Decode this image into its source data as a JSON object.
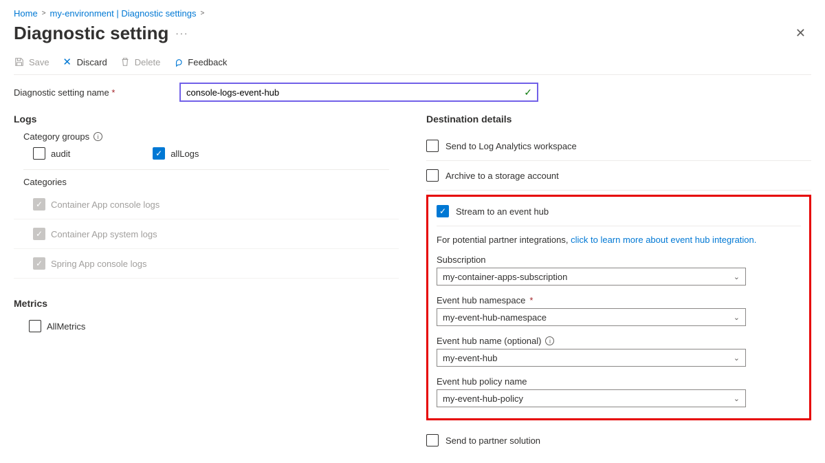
{
  "breadcrumb": {
    "home": "Home",
    "env": "my-environment | Diagnostic settings"
  },
  "page_title": "Diagnostic setting",
  "toolbar": {
    "save": "Save",
    "discard": "Discard",
    "delete": "Delete",
    "feedback": "Feedback"
  },
  "name_field": {
    "label": "Diagnostic setting name",
    "value": "console-logs-event-hub"
  },
  "logs": {
    "heading": "Logs",
    "category_groups_label": "Category groups",
    "groups": {
      "audit": "audit",
      "allLogs": "allLogs"
    },
    "categories_label": "Categories",
    "categories": [
      "Container App console logs",
      "Container App system logs",
      "Spring App console logs"
    ]
  },
  "metrics": {
    "heading": "Metrics",
    "all": "AllMetrics"
  },
  "dest": {
    "heading": "Destination details",
    "law": "Send to Log Analytics workspace",
    "storage": "Archive to a storage account",
    "eventhub": "Stream to an event hub",
    "partner": "Send to partner solution",
    "partner_text": "For potential partner integrations, ",
    "partner_link": "click to learn more about event hub integration.",
    "fields": {
      "sub_label": "Subscription",
      "sub_value": "my-container-apps-subscription",
      "ns_label": "Event hub namespace",
      "ns_value": "my-event-hub-namespace",
      "name_label": "Event hub name (optional)",
      "name_value": "my-event-hub",
      "policy_label": "Event hub policy name",
      "policy_value": "my-event-hub-policy"
    }
  }
}
